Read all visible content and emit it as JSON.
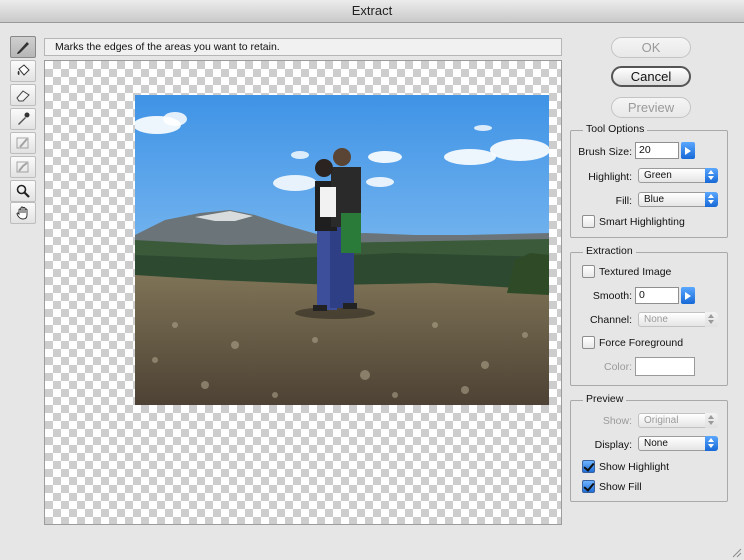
{
  "window": {
    "title": "Extract"
  },
  "hint": "Marks the edges of the areas you want to retain.",
  "tools": [
    {
      "name": "edge-highlighter-tool",
      "icon": "marker-icon",
      "active": true
    },
    {
      "name": "fill-tool",
      "icon": "paint-bucket-icon",
      "active": false
    },
    {
      "name": "eraser-tool",
      "icon": "eraser-icon",
      "active": false
    },
    {
      "name": "eyedropper-tool",
      "icon": "eyedropper-icon",
      "active": false
    },
    {
      "name": "cleanup-tool",
      "icon": "cleanup-icon",
      "active": false
    },
    {
      "name": "edge-touchup-tool",
      "icon": "edge-touchup-icon",
      "active": false
    },
    {
      "name": "zoom-tool",
      "icon": "magnifier-icon",
      "active": false
    },
    {
      "name": "hand-tool",
      "icon": "hand-icon",
      "active": false
    }
  ],
  "buttons": {
    "ok": "OK",
    "cancel": "Cancel",
    "preview": "Preview"
  },
  "tool_options": {
    "title": "Tool Options",
    "brush_size_label": "Brush Size:",
    "brush_size_value": "20",
    "highlight_label": "Highlight:",
    "highlight_value": "Green",
    "fill_label": "Fill:",
    "fill_value": "Blue",
    "smart_highlighting_label": "Smart Highlighting",
    "smart_highlighting_checked": false
  },
  "extraction": {
    "title": "Extraction",
    "textured_image_label": "Textured Image",
    "textured_image_checked": false,
    "smooth_label": "Smooth:",
    "smooth_value": "0",
    "channel_label": "Channel:",
    "channel_value": "None",
    "force_foreground_label": "Force Foreground",
    "force_foreground_checked": false,
    "color_label": "Color:"
  },
  "preview": {
    "title": "Preview",
    "show_label": "Show:",
    "show_value": "Original",
    "display_label": "Display:",
    "display_value": "None",
    "show_highlight_label": "Show Highlight",
    "show_highlight_checked": true,
    "show_fill_label": "Show Fill",
    "show_fill_checked": true
  },
  "colors": {
    "accent": "#1f6fd8",
    "sky": "#5fa9e8",
    "ground": "#6b5e4c"
  }
}
